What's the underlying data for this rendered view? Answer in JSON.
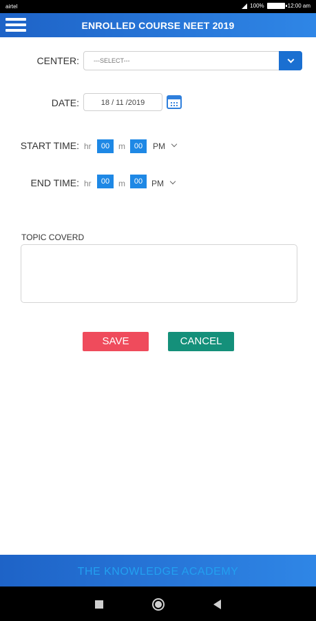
{
  "status_bar": {
    "carrier": "airtel",
    "battery": "100%",
    "time": "12:00 am"
  },
  "app_bar": {
    "title": "ENROLLED COURSE NEET 2019"
  },
  "form": {
    "center": {
      "label": "CENTER:",
      "value": "---SELECT---"
    },
    "date": {
      "label": "DATE:",
      "value": "18 / 11 /2019"
    },
    "start_time": {
      "label": "START TIME:",
      "hr_label": "hr",
      "hour": "00",
      "min_label": "m",
      "minute": "00",
      "period": "PM"
    },
    "end_time": {
      "label": "END TIME:",
      "hr_label": "hr",
      "hour": "00",
      "min_label": "m",
      "minute": "00",
      "period": "PM"
    },
    "topic": {
      "label": "TOPIC COVERD",
      "value": ""
    }
  },
  "actions": {
    "save_label": "SAVE",
    "cancel_label": "CANCEL"
  },
  "footer": {
    "brand": "THE KNOWLEDGE ACADEMY"
  },
  "colors": {
    "primary": "#1e63c7",
    "save": "#ef4b5c",
    "cancel": "#14907a",
    "time_box": "#1e88e5"
  },
  "icons": [
    "menu-icon",
    "chevron-down-icon",
    "calendar-icon",
    "recent-apps-icon",
    "home-icon",
    "back-icon"
  ]
}
